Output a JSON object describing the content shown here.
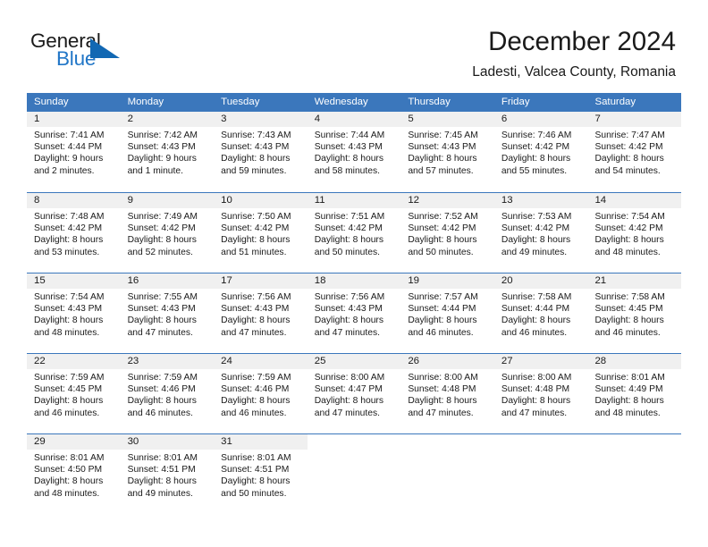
{
  "logo": {
    "word1": "General",
    "word2": "Blue",
    "flag_icon": "blue-flag-triangle",
    "blue_hex": "#2176c7"
  },
  "header": {
    "title": "December 2024",
    "subtitle": "Ladesti, Valcea County, Romania"
  },
  "theme": {
    "header_bg": "#3b77bc",
    "day_band_bg": "#f0f0f0",
    "text": "#1a1a1a"
  },
  "weekdays": [
    "Sunday",
    "Monday",
    "Tuesday",
    "Wednesday",
    "Thursday",
    "Friday",
    "Saturday"
  ],
  "weeks": [
    [
      {
        "day": "1",
        "sunrise": "Sunrise: 7:41 AM",
        "sunset": "Sunset: 4:44 PM",
        "daylight": "Daylight: 9 hours and 2 minutes."
      },
      {
        "day": "2",
        "sunrise": "Sunrise: 7:42 AM",
        "sunset": "Sunset: 4:43 PM",
        "daylight": "Daylight: 9 hours and 1 minute."
      },
      {
        "day": "3",
        "sunrise": "Sunrise: 7:43 AM",
        "sunset": "Sunset: 4:43 PM",
        "daylight": "Daylight: 8 hours and 59 minutes."
      },
      {
        "day": "4",
        "sunrise": "Sunrise: 7:44 AM",
        "sunset": "Sunset: 4:43 PM",
        "daylight": "Daylight: 8 hours and 58 minutes."
      },
      {
        "day": "5",
        "sunrise": "Sunrise: 7:45 AM",
        "sunset": "Sunset: 4:43 PM",
        "daylight": "Daylight: 8 hours and 57 minutes."
      },
      {
        "day": "6",
        "sunrise": "Sunrise: 7:46 AM",
        "sunset": "Sunset: 4:42 PM",
        "daylight": "Daylight: 8 hours and 55 minutes."
      },
      {
        "day": "7",
        "sunrise": "Sunrise: 7:47 AM",
        "sunset": "Sunset: 4:42 PM",
        "daylight": "Daylight: 8 hours and 54 minutes."
      }
    ],
    [
      {
        "day": "8",
        "sunrise": "Sunrise: 7:48 AM",
        "sunset": "Sunset: 4:42 PM",
        "daylight": "Daylight: 8 hours and 53 minutes."
      },
      {
        "day": "9",
        "sunrise": "Sunrise: 7:49 AM",
        "sunset": "Sunset: 4:42 PM",
        "daylight": "Daylight: 8 hours and 52 minutes."
      },
      {
        "day": "10",
        "sunrise": "Sunrise: 7:50 AM",
        "sunset": "Sunset: 4:42 PM",
        "daylight": "Daylight: 8 hours and 51 minutes."
      },
      {
        "day": "11",
        "sunrise": "Sunrise: 7:51 AM",
        "sunset": "Sunset: 4:42 PM",
        "daylight": "Daylight: 8 hours and 50 minutes."
      },
      {
        "day": "12",
        "sunrise": "Sunrise: 7:52 AM",
        "sunset": "Sunset: 4:42 PM",
        "daylight": "Daylight: 8 hours and 50 minutes."
      },
      {
        "day": "13",
        "sunrise": "Sunrise: 7:53 AM",
        "sunset": "Sunset: 4:42 PM",
        "daylight": "Daylight: 8 hours and 49 minutes."
      },
      {
        "day": "14",
        "sunrise": "Sunrise: 7:54 AM",
        "sunset": "Sunset: 4:42 PM",
        "daylight": "Daylight: 8 hours and 48 minutes."
      }
    ],
    [
      {
        "day": "15",
        "sunrise": "Sunrise: 7:54 AM",
        "sunset": "Sunset: 4:43 PM",
        "daylight": "Daylight: 8 hours and 48 minutes."
      },
      {
        "day": "16",
        "sunrise": "Sunrise: 7:55 AM",
        "sunset": "Sunset: 4:43 PM",
        "daylight": "Daylight: 8 hours and 47 minutes."
      },
      {
        "day": "17",
        "sunrise": "Sunrise: 7:56 AM",
        "sunset": "Sunset: 4:43 PM",
        "daylight": "Daylight: 8 hours and 47 minutes."
      },
      {
        "day": "18",
        "sunrise": "Sunrise: 7:56 AM",
        "sunset": "Sunset: 4:43 PM",
        "daylight": "Daylight: 8 hours and 47 minutes."
      },
      {
        "day": "19",
        "sunrise": "Sunrise: 7:57 AM",
        "sunset": "Sunset: 4:44 PM",
        "daylight": "Daylight: 8 hours and 46 minutes."
      },
      {
        "day": "20",
        "sunrise": "Sunrise: 7:58 AM",
        "sunset": "Sunset: 4:44 PM",
        "daylight": "Daylight: 8 hours and 46 minutes."
      },
      {
        "day": "21",
        "sunrise": "Sunrise: 7:58 AM",
        "sunset": "Sunset: 4:45 PM",
        "daylight": "Daylight: 8 hours and 46 minutes."
      }
    ],
    [
      {
        "day": "22",
        "sunrise": "Sunrise: 7:59 AM",
        "sunset": "Sunset: 4:45 PM",
        "daylight": "Daylight: 8 hours and 46 minutes."
      },
      {
        "day": "23",
        "sunrise": "Sunrise: 7:59 AM",
        "sunset": "Sunset: 4:46 PM",
        "daylight": "Daylight: 8 hours and 46 minutes."
      },
      {
        "day": "24",
        "sunrise": "Sunrise: 7:59 AM",
        "sunset": "Sunset: 4:46 PM",
        "daylight": "Daylight: 8 hours and 46 minutes."
      },
      {
        "day": "25",
        "sunrise": "Sunrise: 8:00 AM",
        "sunset": "Sunset: 4:47 PM",
        "daylight": "Daylight: 8 hours and 47 minutes."
      },
      {
        "day": "26",
        "sunrise": "Sunrise: 8:00 AM",
        "sunset": "Sunset: 4:48 PM",
        "daylight": "Daylight: 8 hours and 47 minutes."
      },
      {
        "day": "27",
        "sunrise": "Sunrise: 8:00 AM",
        "sunset": "Sunset: 4:48 PM",
        "daylight": "Daylight: 8 hours and 47 minutes."
      },
      {
        "day": "28",
        "sunrise": "Sunrise: 8:01 AM",
        "sunset": "Sunset: 4:49 PM",
        "daylight": "Daylight: 8 hours and 48 minutes."
      }
    ],
    [
      {
        "day": "29",
        "sunrise": "Sunrise: 8:01 AM",
        "sunset": "Sunset: 4:50 PM",
        "daylight": "Daylight: 8 hours and 48 minutes."
      },
      {
        "day": "30",
        "sunrise": "Sunrise: 8:01 AM",
        "sunset": "Sunset: 4:51 PM",
        "daylight": "Daylight: 8 hours and 49 minutes."
      },
      {
        "day": "31",
        "sunrise": "Sunrise: 8:01 AM",
        "sunset": "Sunset: 4:51 PM",
        "daylight": "Daylight: 8 hours and 50 minutes."
      },
      {
        "day": "",
        "sunrise": "",
        "sunset": "",
        "daylight": ""
      },
      {
        "day": "",
        "sunrise": "",
        "sunset": "",
        "daylight": ""
      },
      {
        "day": "",
        "sunrise": "",
        "sunset": "",
        "daylight": ""
      },
      {
        "day": "",
        "sunrise": "",
        "sunset": "",
        "daylight": ""
      }
    ]
  ]
}
